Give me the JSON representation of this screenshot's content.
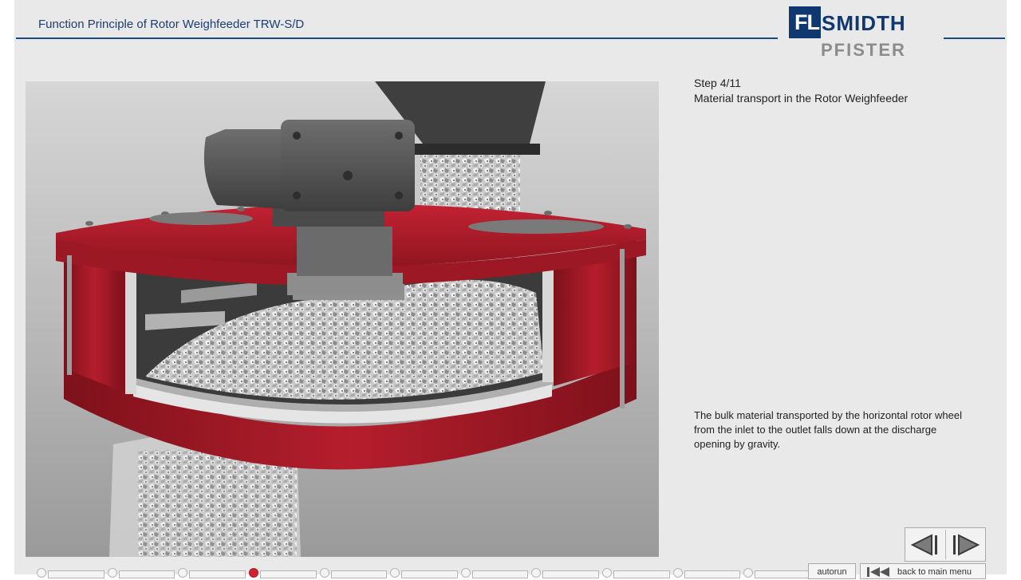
{
  "header": {
    "title": "Function Principle of Rotor Weighfeeder TRW-S/D"
  },
  "logo": {
    "fl": "FL",
    "smidth": "SMIDTH",
    "pfister": "PFISTER"
  },
  "step": {
    "number": "Step 4/11",
    "title": "Material transport in the Rotor Weighfeeder",
    "description": "The bulk material transported by the horizontal rotor wheel from the inlet to the outlet falls down at the discharge opening by gravity."
  },
  "navigation": {
    "prev_icon": "triangle-left-icon",
    "next_icon": "triangle-right-icon"
  },
  "progress": {
    "total_steps": 11,
    "current_step": 4
  },
  "bottom_bar": {
    "autorun_label": "autorun",
    "back_menu_label": "back to main menu"
  },
  "colors": {
    "brand_blue": "#0f3770",
    "header_line": "#1d4a86",
    "rotor_red": "#b01d2a",
    "current_step": "#d0232f"
  }
}
